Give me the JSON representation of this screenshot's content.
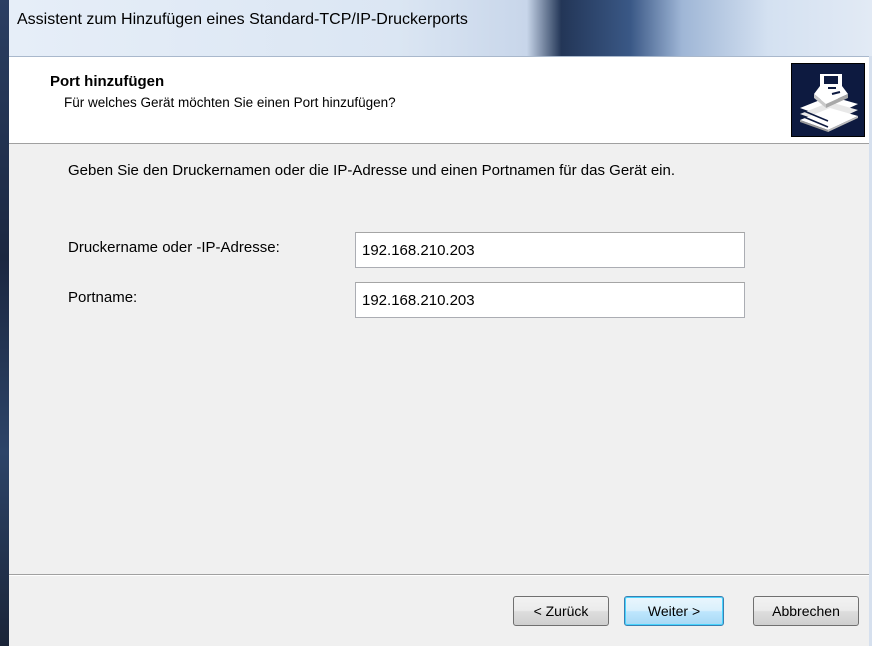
{
  "window": {
    "title": "Assistent zum Hinzufügen eines Standard-TCP/IP-Druckerports"
  },
  "header": {
    "title": "Port hinzufügen",
    "subtitle": "Für welches Gerät möchten Sie einen Port hinzufügen?",
    "icon": "printer-icon"
  },
  "content": {
    "instruction": "Geben Sie den Druckernamen oder die IP-Adresse und einen Portnamen für das Gerät ein.",
    "fields": [
      {
        "label": "Druckername oder -IP-Adresse:",
        "value": "192.168.210.203"
      },
      {
        "label": "Portname:",
        "value": "192.168.210.203"
      }
    ]
  },
  "footer": {
    "back_label": "< Zurück",
    "next_label": "Weiter >",
    "cancel_label": "Abbrechen"
  },
  "colors": {
    "header_background": "#ffffff",
    "content_background": "#f0f0f0",
    "default_button_border": "#3c7fb1"
  }
}
